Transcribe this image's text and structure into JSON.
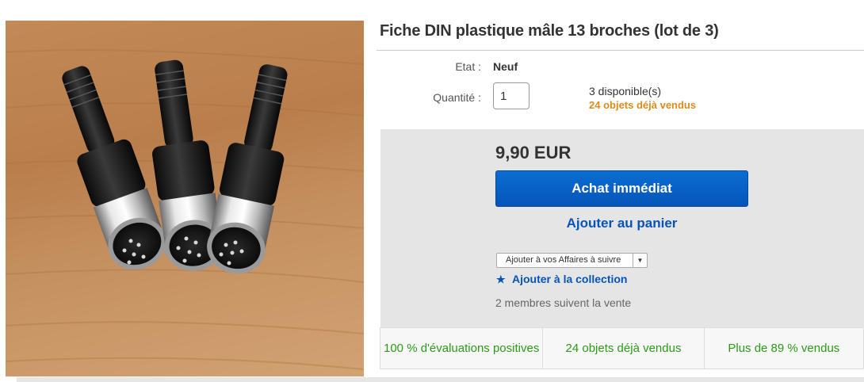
{
  "product": {
    "title": "Fiche DIN plastique mâle 13 broches (lot de 3)",
    "image_alt": "Trois fiches DIN mâles noires et chromées sur une table en bois"
  },
  "details": {
    "condition_label": "Etat :",
    "condition_value": "Neuf",
    "quantity_label": "Quantité :",
    "quantity_value": "1",
    "available": "3 disponible(s)",
    "sold": "24 objets déjà vendus"
  },
  "buybox": {
    "price": "9,90 EUR",
    "buy_now_label": "Achat immédiat",
    "add_to_cart_label": "Ajouter au panier",
    "watch_dropdown_label": "Ajouter à vos Affaires à suivre",
    "add_collection_label": "Ajouter à la collection",
    "followers": "2 membres suivent la vente"
  },
  "stats": [
    {
      "text": "100 % d'évaluations positives"
    },
    {
      "text": "24 objets déjà vendus"
    },
    {
      "text": "Plus de 89 % vendus"
    }
  ],
  "colors": {
    "link_blue": "#0654ba",
    "sold_orange": "#dd8a1c",
    "stat_green": "#2c9a18",
    "buy_button": "#0654ba"
  },
  "icons": {
    "collection": "star-icon",
    "dropdown": "caret-down-icon"
  }
}
